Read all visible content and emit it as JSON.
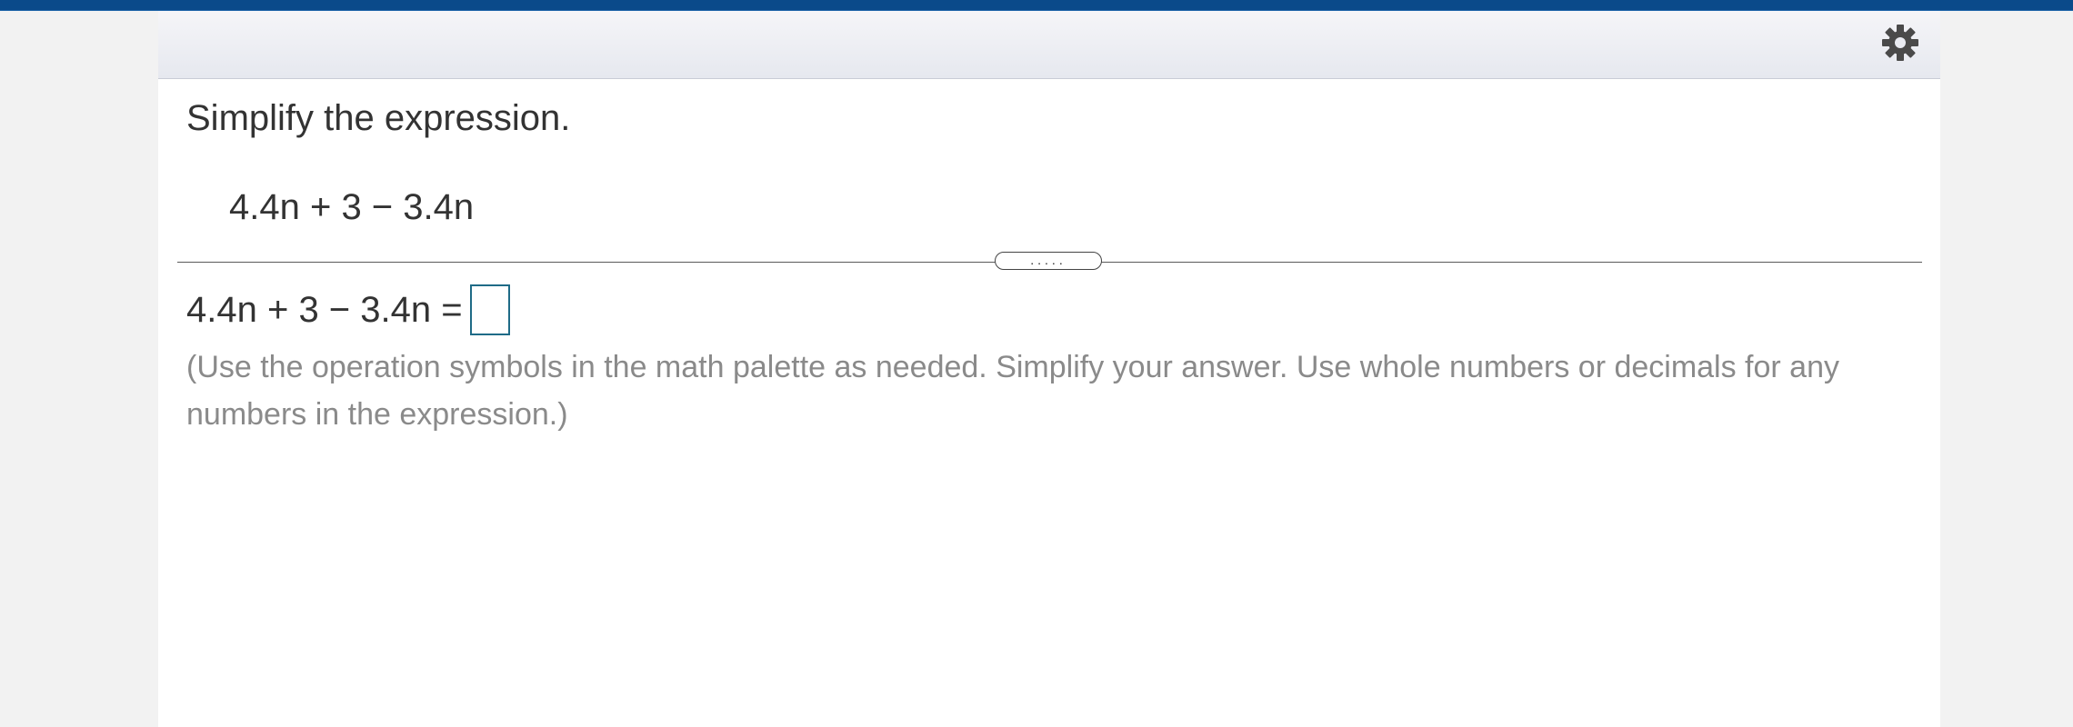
{
  "question": {
    "prompt": "Simplify the expression.",
    "expression": "4.4n + 3 − 3.4n"
  },
  "answer": {
    "lhs": "4.4n + 3 − 3.4n =",
    "value": ""
  },
  "instructions": "(Use the operation symbols in the math palette as needed. Simplify your answer. Use whole numbers or decimals for any numbers in the expression.)",
  "divider": {
    "handle_label": "....."
  },
  "icons": {
    "settings": "gear-icon"
  },
  "colors": {
    "top_stripe": "#0a4a8a",
    "answer_box_border": "#1f6b87",
    "text": "#333333",
    "instruction_text": "#8a8a8a"
  }
}
